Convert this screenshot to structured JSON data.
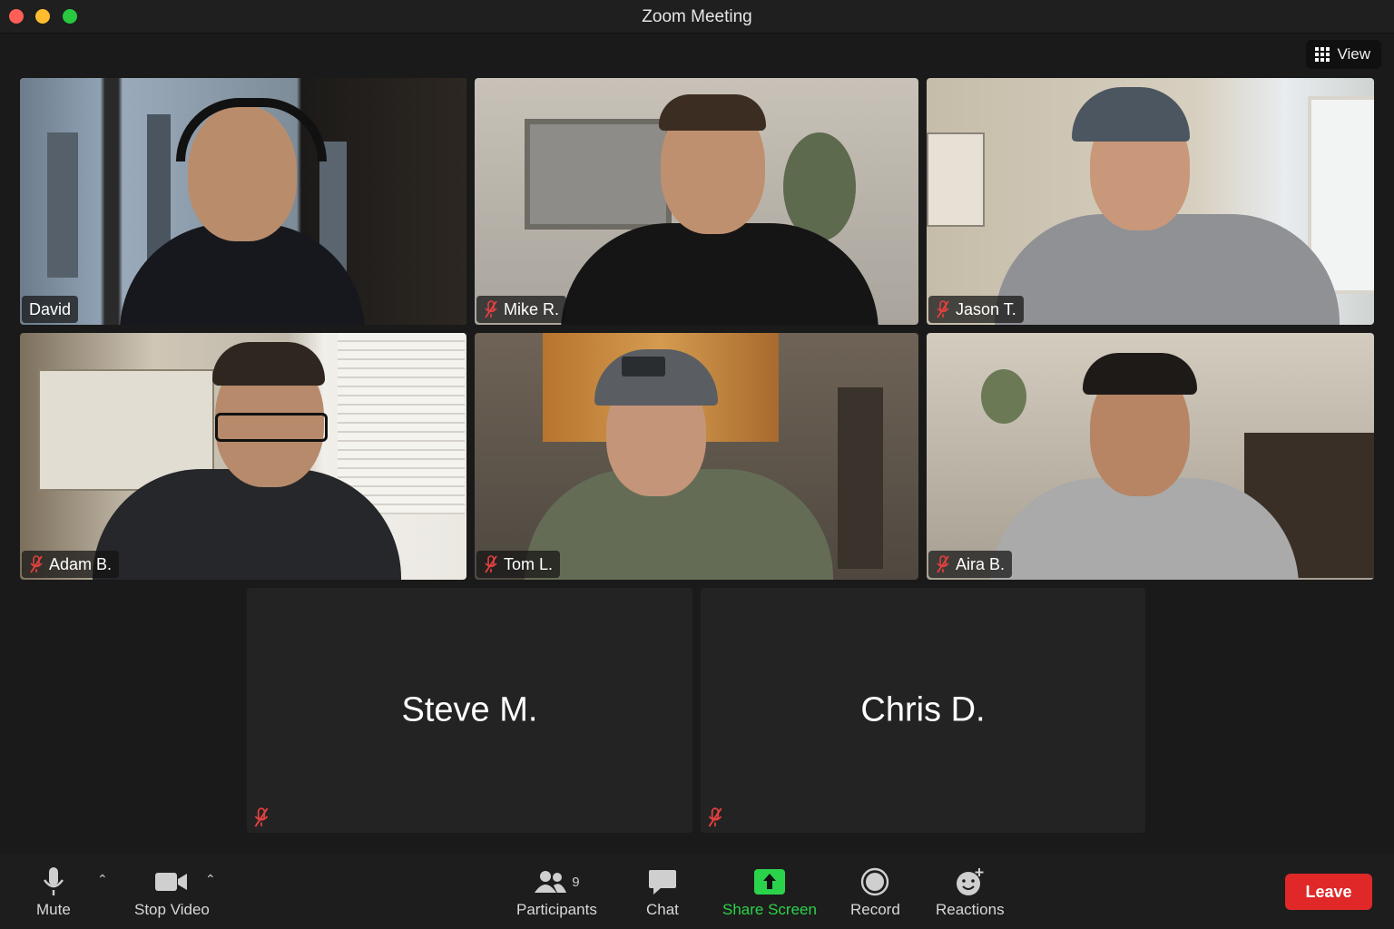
{
  "window": {
    "title": "Zoom Meeting"
  },
  "view": {
    "label": "View"
  },
  "participants": [
    {
      "name": "David",
      "muted": false,
      "active": true
    },
    {
      "name": "Mike R.",
      "muted": true
    },
    {
      "name": "Jason T.",
      "muted": true
    },
    {
      "name": "Adam B.",
      "muted": true
    },
    {
      "name": "Tom L.",
      "muted": true
    },
    {
      "name": "Aira B.",
      "muted": true
    },
    {
      "name": "Steve M.",
      "muted": true,
      "video": false
    },
    {
      "name": "Chris D.",
      "muted": true,
      "video": false
    }
  ],
  "toolbar": {
    "mute": "Mute",
    "stop_video": "Stop Video",
    "participants": "Participants",
    "participants_count": "9",
    "chat": "Chat",
    "share_screen": "Share Screen",
    "record": "Record",
    "reactions": "Reactions",
    "leave": "Leave"
  },
  "colors": {
    "active_speaker": "#2bd34a",
    "leave": "#e02828",
    "share": "#2bd34a"
  }
}
